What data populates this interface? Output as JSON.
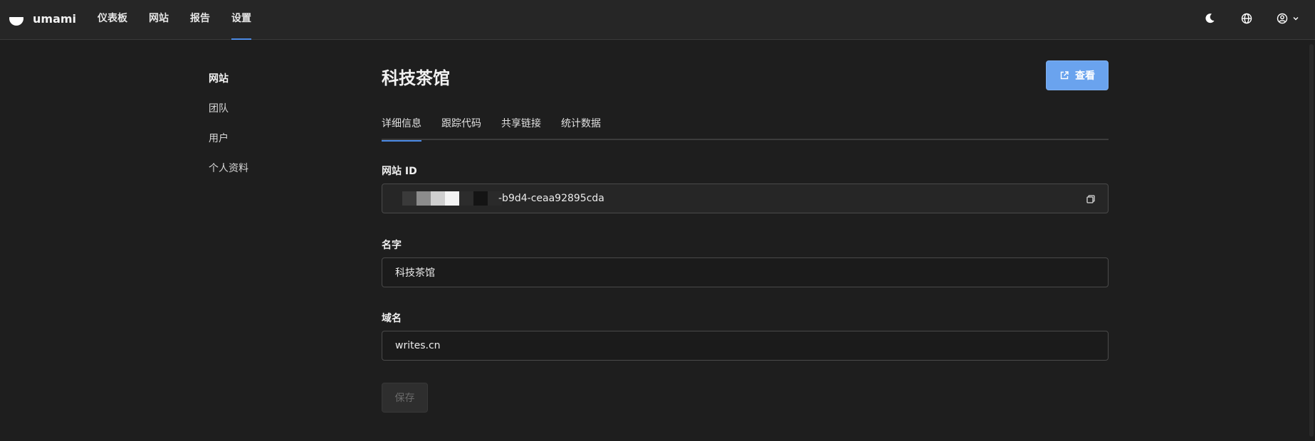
{
  "app": {
    "name": "umami"
  },
  "nav": {
    "items": [
      {
        "label": "仪表板",
        "active": false
      },
      {
        "label": "网站",
        "active": false
      },
      {
        "label": "报告",
        "active": false
      },
      {
        "label": "设置",
        "active": true
      }
    ]
  },
  "topbar": {
    "icons": [
      "moon-icon",
      "globe-icon",
      "user-circle-icon",
      "chevron-down-icon"
    ]
  },
  "sidebar": {
    "items": [
      {
        "label": "网站",
        "active": true
      },
      {
        "label": "团队",
        "active": false
      },
      {
        "label": "用户",
        "active": false
      },
      {
        "label": "个人资料",
        "active": false
      }
    ]
  },
  "page": {
    "title": "科技茶馆",
    "view_button": "查看",
    "tabs": [
      {
        "label": "详细信息",
        "active": true
      },
      {
        "label": "跟踪代码",
        "active": false
      },
      {
        "label": "共享链接",
        "active": false
      },
      {
        "label": "统计数据",
        "active": false
      }
    ]
  },
  "form": {
    "website_id": {
      "label": "网站 ID",
      "visible_suffix": "-b9d4-ceaa92895cda"
    },
    "name": {
      "label": "名字",
      "value": "科技茶馆"
    },
    "domain": {
      "label": "域名",
      "value": "writes.cn"
    },
    "save_button": "保存"
  },
  "colors": {
    "accent": "#4c8be6",
    "primary_button": "#6aa3ee",
    "background": "#1e1e1e",
    "topbar": "#262626"
  }
}
